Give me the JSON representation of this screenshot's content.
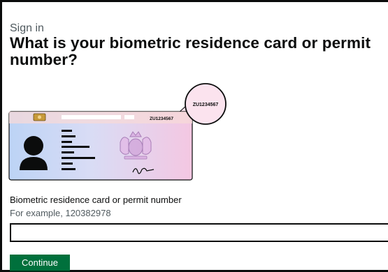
{
  "page": {
    "caption": "Sign in",
    "heading": "What is your biometric residence card or permit number?"
  },
  "illustration": {
    "card_number": "ZU1234567",
    "magnified_number": "ZU1234567"
  },
  "form": {
    "field_label": "Biometric residence card or permit number",
    "field_hint": "For example, 120382978",
    "field_value": "",
    "continue_label": "Continue"
  },
  "colors": {
    "button": "#00703c",
    "text": "#0b0c0c",
    "secondary_text": "#505a5f",
    "card_gradient_start": "#bcd3f5",
    "card_gradient_end": "#f4c7e2"
  }
}
